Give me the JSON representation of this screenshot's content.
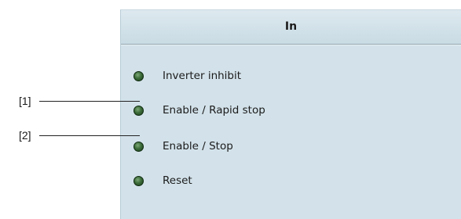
{
  "panel": {
    "title": "In",
    "items": [
      {
        "label": "Inverter inhibit",
        "status_color": "#3c6d39"
      },
      {
        "label": "Enable / Rapid stop",
        "status_color": "#3c6d39"
      },
      {
        "label": "Enable / Stop",
        "status_color": "#3c6d39"
      },
      {
        "label": "Reset",
        "status_color": "#3c6d39"
      }
    ]
  },
  "callouts": [
    {
      "label": "[1]"
    },
    {
      "label": "[2]"
    }
  ],
  "colors": {
    "panel_background": "#d3e2ea",
    "led_green": "#3c6d39"
  }
}
